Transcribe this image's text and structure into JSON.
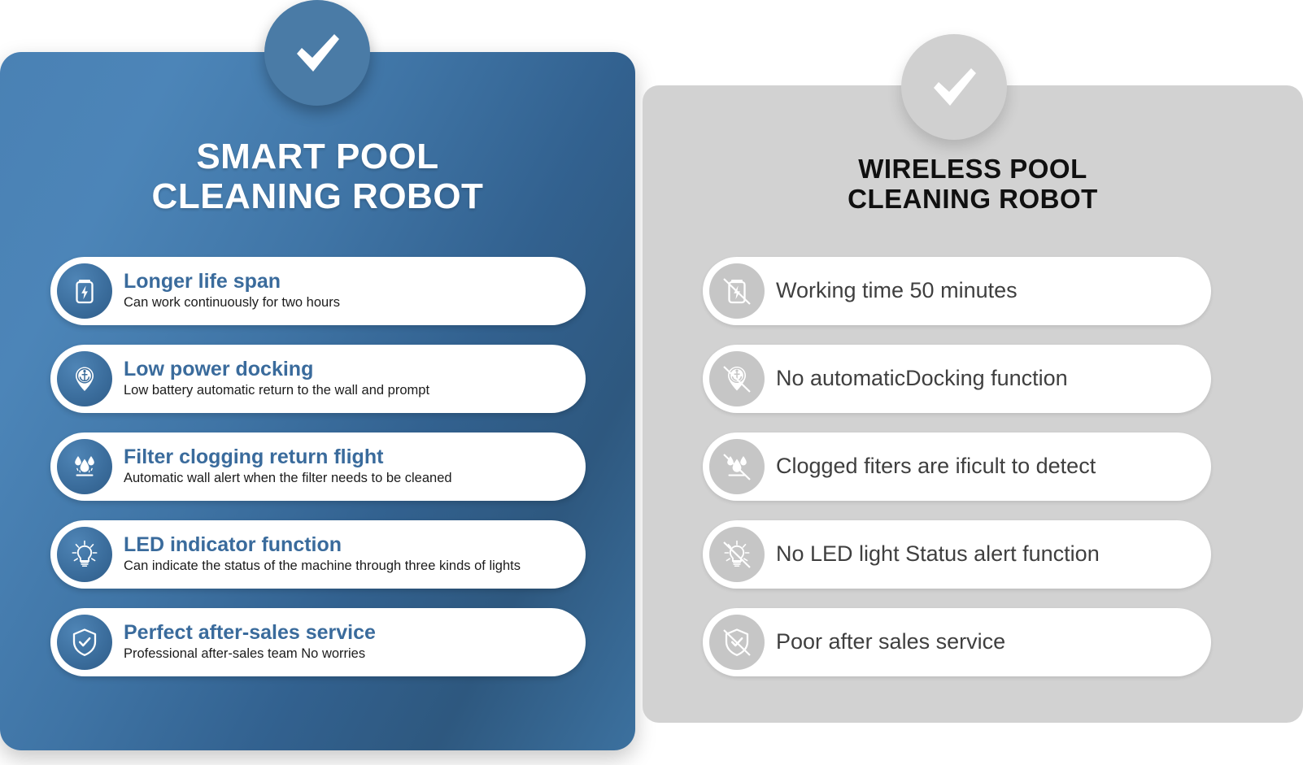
{
  "pro": {
    "title_line1": "SMART POOL",
    "title_line2": "CLEANING ROBOT",
    "badge_icon": "check-icon",
    "accent_color": "#3a6b9c",
    "panel_gradient_from": "#4c85b8",
    "panel_gradient_to": "#2e587f",
    "features": [
      {
        "icon": "battery-bolt-icon",
        "title": "Longer life span",
        "desc": "Can work continuously for two hours"
      },
      {
        "icon": "map-pin-anchor-icon",
        "title": "Low power docking",
        "desc": "Low battery automatic return to the wall and prompt"
      },
      {
        "icon": "water-droplets-filter-icon",
        "title": "Filter clogging return flight",
        "desc": "Automatic wall alert when the filter needs to be cleaned"
      },
      {
        "icon": "light-bulb-icon",
        "title": "LED indicator function",
        "desc": "Can indicate the status of the machine through three kinds of lights"
      },
      {
        "icon": "shield-check-icon",
        "title": "Perfect after-sales service",
        "desc": "Professional after-sales team No worries"
      }
    ]
  },
  "con": {
    "title_line1": "WIRELESS POOL",
    "title_line2": "CLEANING ROBOT",
    "badge_icon": "check-icon",
    "panel_color": "#d2d2d2",
    "icon_color": "#c6c6c6",
    "text_color": "#3f3f3f",
    "features": [
      {
        "icon": "battery-bolt-disabled-icon",
        "label": "Working time 50 minutes"
      },
      {
        "icon": "map-pin-anchor-disabled-icon",
        "label": "No automaticDocking function"
      },
      {
        "icon": "water-droplets-filter-disabled-icon",
        "label": "Clogged fiters are ificult to detect"
      },
      {
        "icon": "light-bulb-disabled-icon",
        "label": "No LED light Status alert function"
      },
      {
        "icon": "shield-check-disabled-icon",
        "label": "Poor after sales service"
      }
    ]
  }
}
